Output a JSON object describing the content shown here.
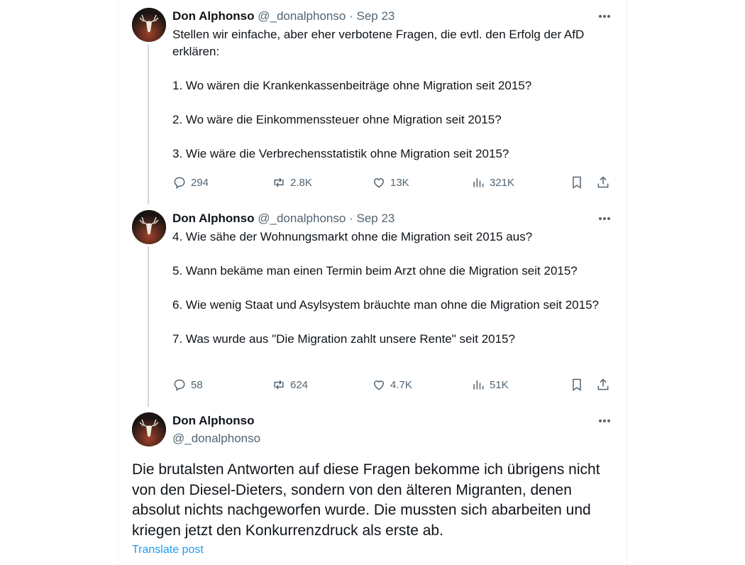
{
  "author": {
    "name": "Don Alphonso",
    "handle": "@_donalphonso"
  },
  "tweets": [
    {
      "date": "Sep 23",
      "text": "Stellen wir einfache, aber eher verbotene Fragen, die evtl. den Erfolg der AfD erklären:\n\n1. Wo wären die Krankenkassenbeiträge ohne Migration seit 2015?\n\n2. Wo wäre die Einkommenssteuer ohne Migration seit 2015?\n\n3. Wie wäre die Verbrechensstatistik ohne Migration seit 2015?",
      "replies": "294",
      "retweets": "2.8K",
      "likes": "13K",
      "views": "321K"
    },
    {
      "date": "Sep 23",
      "text": "4. Wie sähe der Wohnungsmarkt ohne die Migration seit 2015 aus?\n\n5. Wann bekäme man einen Termin beim Arzt ohne die Migration seit 2015?\n\n6. Wie wenig Staat und Asylsystem bräuchte man ohne die Migration seit 2015?\n\n7. Was wurde aus \"Die Migration zahlt unsere Rente\" seit 2015?",
      "replies": "58",
      "retweets": "624",
      "likes": "4.7K",
      "views": "51K"
    }
  ],
  "main_tweet": {
    "text": "Die brutalsten Antworten auf diese Fragen bekomme ich übrigens nicht von den Diesel-Dieters, sondern von den älteren Migranten, denen absolut nichts nachgeworfen wurde. Die mussten sich abarbeiten und kriegen jetzt den Konkurrenzdruck als erste ab.",
    "translate_label": "Translate post"
  },
  "separator": "·",
  "icons": {
    "more": "more-dots-icon",
    "reply": "reply-icon",
    "retweet": "retweet-icon",
    "like": "heart-icon",
    "views": "views-icon",
    "bookmark": "bookmark-icon",
    "share": "share-icon"
  },
  "colors": {
    "text": "#0f1419",
    "secondary": "#536471",
    "link": "#1d9bf0",
    "thread_line": "#cfd9de"
  }
}
